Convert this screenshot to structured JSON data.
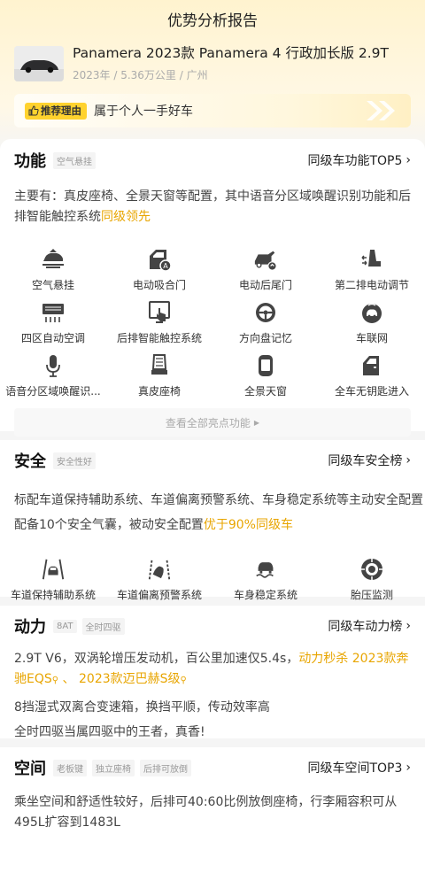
{
  "page_title": "优势分析报告",
  "car": {
    "name": "Panamera 2023款 Panamera 4 行政加长版 2.9T",
    "meta": "2023年 / 5.36万公里 / 广州"
  },
  "reason": {
    "badge": "推荐理由",
    "text": "属于个人一手好车"
  },
  "function": {
    "title": "功能",
    "tags": [
      "空气悬挂"
    ],
    "link": "同级车功能TOP5",
    "desc_prefix": "主要有：真皮座椅、全景天窗等配置，其中语音分区域唤醒识别功能和后排智能触控系统",
    "desc_highlight": "同级领先",
    "features": [
      {
        "label": "空气悬挂",
        "icon": "air-suspension-icon"
      },
      {
        "label": "电动吸合门",
        "icon": "soft-close-door-icon"
      },
      {
        "label": "电动后尾门",
        "icon": "power-tailgate-icon"
      },
      {
        "label": "第二排电动调节",
        "icon": "second-row-seat-icon"
      },
      {
        "label": "四区自动空调",
        "icon": "climate-control-icon"
      },
      {
        "label": "后排智能触控系统",
        "icon": "rear-touch-control-icon"
      },
      {
        "label": "方向盘记忆",
        "icon": "steering-wheel-icon"
      },
      {
        "label": "车联网",
        "icon": "connected-car-icon"
      },
      {
        "label": "语音分区域唤醒识...",
        "icon": "voice-recognition-icon"
      },
      {
        "label": "真皮座椅",
        "icon": "leather-seat-icon"
      },
      {
        "label": "全景天窗",
        "icon": "panoramic-sunroof-icon"
      },
      {
        "label": "全车无钥匙进入",
        "icon": "keyless-entry-icon"
      }
    ],
    "view_all": "查看全部亮点功能"
  },
  "safety": {
    "title": "安全",
    "tags": [
      "安全性好"
    ],
    "link": "同级车安全榜",
    "line1": "标配车道保持辅助系统、车道偏离预警系统、车身稳定系统等主动安全配置",
    "line2_prefix": "配备10个安全气囊，被动安全配置",
    "line2_highlight": "优于90%同级车",
    "features": [
      {
        "label": "车道保持辅助系统",
        "icon": "lane-keep-icon"
      },
      {
        "label": "车道偏离预警系统",
        "icon": "lane-departure-icon"
      },
      {
        "label": "车身稳定系统",
        "icon": "stability-control-icon"
      },
      {
        "label": "胎压监测",
        "icon": "tire-pressure-icon"
      }
    ]
  },
  "power": {
    "title": "动力",
    "tags": [
      "8AT",
      "全时四驱"
    ],
    "link": "同级车动力榜",
    "line1_prefix": "2.9T V6，双涡轮增压发动机，百公里加速仅5.4s，",
    "line1_highlight1": "动力秒杀 2023款奔驰EQS",
    "line1_sep": " 、 ",
    "line1_highlight2": "2023款迈巴赫S级",
    "line2": "8挡湿式双离合变速箱，换挡平顺，传动效率高",
    "line3": "全时四驱当属四驱中的王者，真香!"
  },
  "space": {
    "title": "空间",
    "tags": [
      "老板键",
      "独立座椅",
      "后排可放倒"
    ],
    "link": "同级车空间TOP3",
    "text": "乘坐空间和舒适性较好，后排可40:60比例放倒座椅，行李厢容积可从495L扩容到1483L"
  },
  "colors": {
    "accent": "#e8a500",
    "badge": "#ffd22e",
    "header_bg": "#fff3cf",
    "icon": "#444444"
  }
}
